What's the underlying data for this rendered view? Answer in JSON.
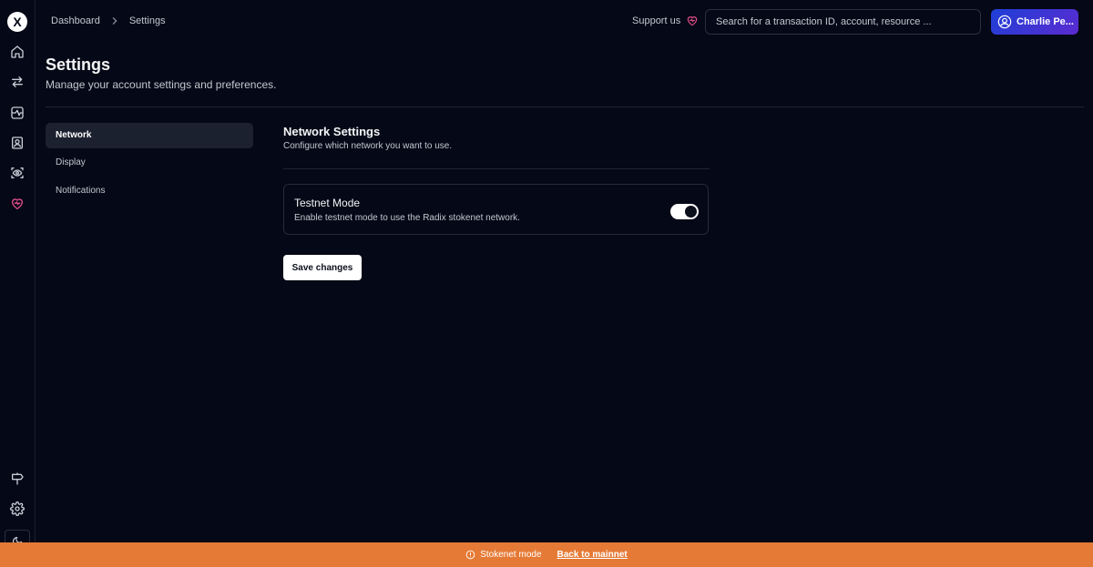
{
  "app": {
    "logo_letter": "X",
    "brand_color": "#e04e8a",
    "user_gradient": [
      "#1e3fd6",
      "#5b2bd1"
    ]
  },
  "rail": {
    "items": [
      {
        "name": "home-icon"
      },
      {
        "name": "transfer-icon"
      },
      {
        "name": "network-icon"
      },
      {
        "name": "contacts-icon"
      },
      {
        "name": "eye-icon"
      },
      {
        "name": "heart-icon"
      }
    ],
    "bottom_items": [
      {
        "name": "signpost-icon"
      },
      {
        "name": "gear-icon"
      },
      {
        "name": "moon-icon"
      }
    ]
  },
  "header": {
    "breadcrumb": [
      "Dashboard",
      "Settings"
    ],
    "support_label": "Support us",
    "search_placeholder": "Search for a transaction ID, account, resource ...",
    "user_name": "Charlie Pe..."
  },
  "page": {
    "title": "Settings",
    "subtitle": "Manage your account settings and preferences."
  },
  "settings_nav": {
    "items": [
      {
        "label": "Network",
        "active": true
      },
      {
        "label": "Display",
        "active": false
      },
      {
        "label": "Notifications",
        "active": false
      }
    ]
  },
  "network": {
    "title": "Network Settings",
    "subtitle": "Configure which network you want to use.",
    "testnet": {
      "title": "Testnet Mode",
      "description": "Enable testnet mode to use the Radix stokenet network.",
      "enabled": true
    },
    "save_label": "Save changes"
  },
  "banner": {
    "mode_label": "Stokenet mode",
    "link_label": "Back to mainnet",
    "color": "#e57a36"
  }
}
